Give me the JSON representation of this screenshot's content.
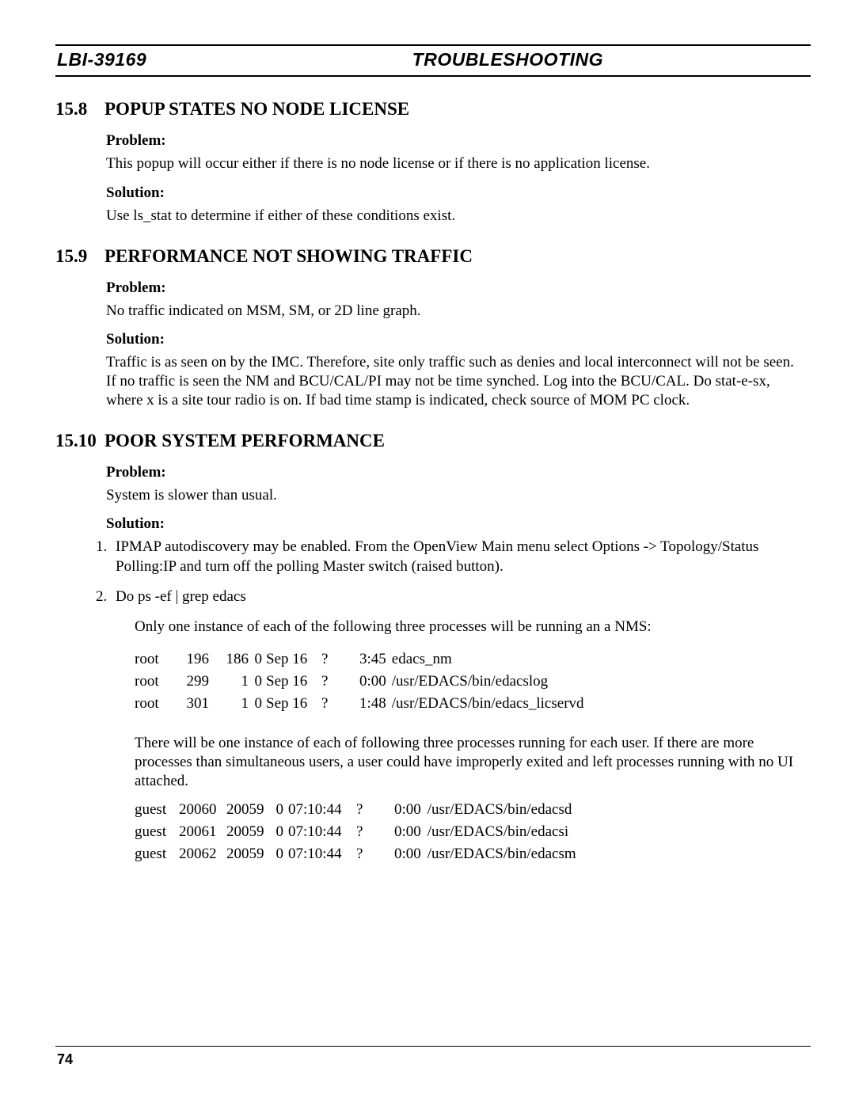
{
  "header": {
    "doc_id": "LBI-39169",
    "title": "TROUBLESHOOTING"
  },
  "sections": [
    {
      "num": "15.8",
      "title": "POPUP STATES NO NODE LICENSE",
      "problem_label": "Problem:",
      "problem": "This popup will occur either if there is no node license or if there is no application license.",
      "solution_label": "Solution:",
      "solution": "Use ls_stat to determine if either of these conditions exist."
    },
    {
      "num": "15.9",
      "title": "PERFORMANCE NOT SHOWING TRAFFIC",
      "problem_label": "Problem:",
      "problem": "No traffic indicated on MSM, SM, or 2D line graph.",
      "solution_label": "Solution:",
      "solution": "Traffic is as seen on by the IMC.  Therefore, site only traffic such as denies and local interconnect will not be seen.  If no traffic is seen the NM and BCU/CAL/PI may not be time synched.  Log into the BCU/CAL.  Do stat-e-sx, where x is a site tour radio is on.  If bad time stamp is indicated, check source of MOM PC clock."
    },
    {
      "num": "15.10",
      "title": "POOR SYSTEM PERFORMANCE",
      "problem_label": "Problem:",
      "problem": "System is slower than usual.",
      "solution_label": "Solution:",
      "steps": [
        "IPMAP autodiscovery may be enabled.  From the OpenView Main menu select Options -> Topology/Status Polling:IP and turn off the polling Master switch (raised button).",
        "Do ps -ef | grep edacs"
      ],
      "after_step2_a": "Only one instance of each of the following three processes will be running an a NMS:",
      "proc_rows_a": [
        {
          "user": "root",
          "pid": "196",
          "ppid": "186",
          "c": "0",
          "date": "Sep 16",
          "tty": "?",
          "time": "3:45",
          "cmd": "edacs_nm"
        },
        {
          "user": "root",
          "pid": "299",
          "ppid": "1",
          "c": "0",
          "date": "Sep 16",
          "tty": "?",
          "time": "0:00",
          "cmd": "/usr/EDACS/bin/edacslog"
        },
        {
          "user": "root",
          "pid": "301",
          "ppid": "1",
          "c": "0",
          "date": "Sep 16",
          "tty": "?",
          "time": "1:48",
          "cmd": "/usr/EDACS/bin/edacs_licservd"
        }
      ],
      "after_step2_b": "There will be one instance of each of following three processes running for each user.  If there are more processes than simultaneous users, a user could have improperly exited and left processes running with no UI attached.",
      "proc_rows_b": [
        {
          "user": "guest",
          "pid": "20060",
          "ppid": "20059",
          "c": "0",
          "date": "07:10:44",
          "tty": "?",
          "time": "0:00",
          "cmd": "/usr/EDACS/bin/edacsd"
        },
        {
          "user": "guest",
          "pid": "20061",
          "ppid": "20059",
          "c": "0",
          "date": "07:10:44",
          "tty": "?",
          "time": "0:00",
          "cmd": "/usr/EDACS/bin/edacsi"
        },
        {
          "user": "guest",
          "pid": "20062",
          "ppid": "20059",
          "c": "0",
          "date": "07:10:44",
          "tty": "?",
          "time": "0:00",
          "cmd": "/usr/EDACS/bin/edacsm"
        }
      ]
    }
  ],
  "footer": {
    "page_num": "74"
  }
}
